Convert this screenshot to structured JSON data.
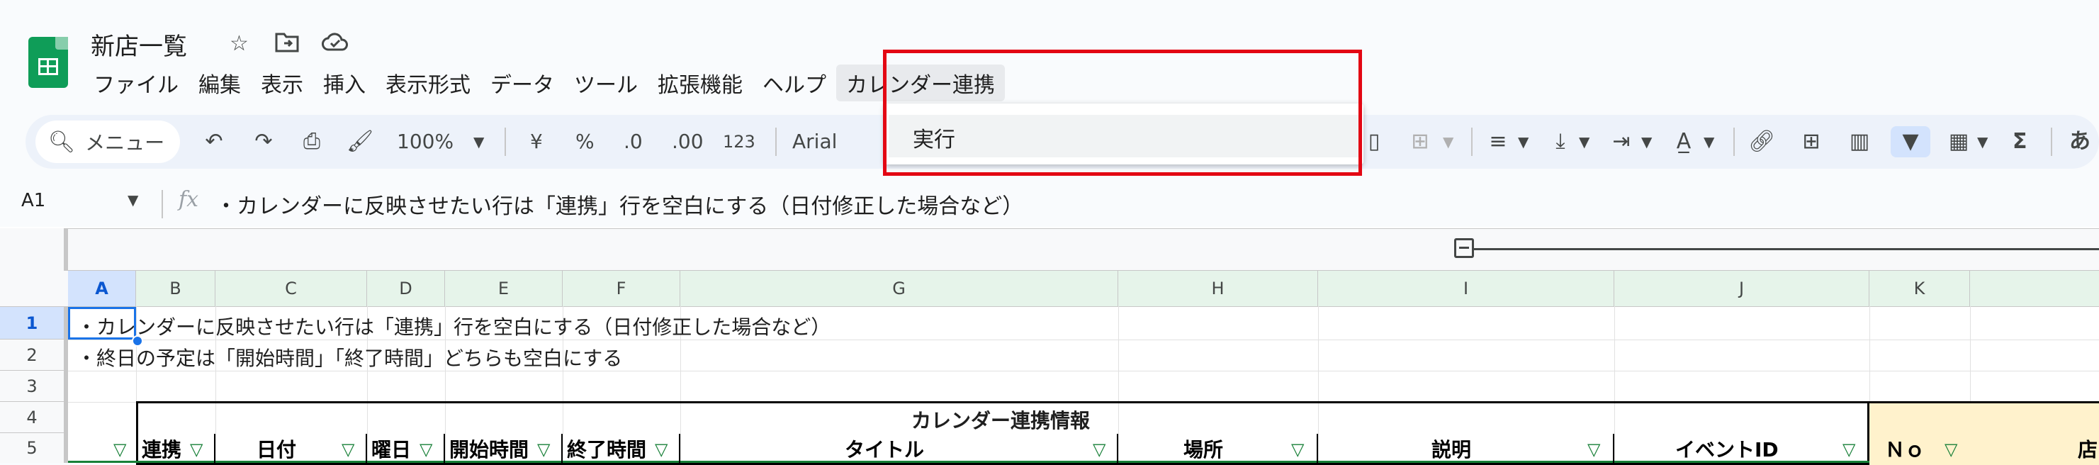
{
  "app": {
    "doc_title": "新店一覧",
    "title_icons": [
      "star-icon",
      "move-to-folder-icon",
      "cloud-saved-icon"
    ]
  },
  "menubar": {
    "items": [
      "ファイル",
      "編集",
      "表示",
      "挿入",
      "表示形式",
      "データ",
      "ツール",
      "拡張機能",
      "ヘルプ",
      "カレンダー連携"
    ]
  },
  "dropdown": {
    "items": [
      "実行"
    ]
  },
  "toolbar": {
    "menu_search_label": "メニュー",
    "zoom": "100%",
    "currency": "¥",
    "percent": "%",
    "decrease_decimal": ".0",
    "increase_decimal": ".00",
    "number_format": "123",
    "font": "Arial",
    "input_tool": "あ",
    "sum": "Σ"
  },
  "formula_bar": {
    "cell_ref": "A1",
    "fx": "fx",
    "content": "・カレンダーに反映させたい行は「連携」行を空白にする（日付修正した場合など）"
  },
  "grid": {
    "columns": [
      "A",
      "B",
      "C",
      "D",
      "E",
      "F",
      "G",
      "H",
      "I",
      "J",
      "K"
    ],
    "rows": [
      "1",
      "2",
      "3",
      "4",
      "5"
    ],
    "row1_text": "・カレンダーに反映させたい行は「連携」行を空白にする（日付修正した場合など）",
    "row2_text": "・終日の予定は「開始時間」「終了時間」どちらも空白にする",
    "calendar_header": "カレンダー連携情報",
    "headers": [
      "連携",
      "日付",
      "曜日",
      "開始時間",
      "終了時間",
      "タイトル",
      "場所",
      "説明",
      "イベントID",
      "Ｎｏ",
      "店"
    ]
  },
  "colors": {
    "sheets_green": "#0f9d58",
    "selection_blue": "#1a73e8",
    "highlight_red": "#e30613",
    "filter_green": "#188038",
    "yellow_fill": "#fff2cc"
  }
}
